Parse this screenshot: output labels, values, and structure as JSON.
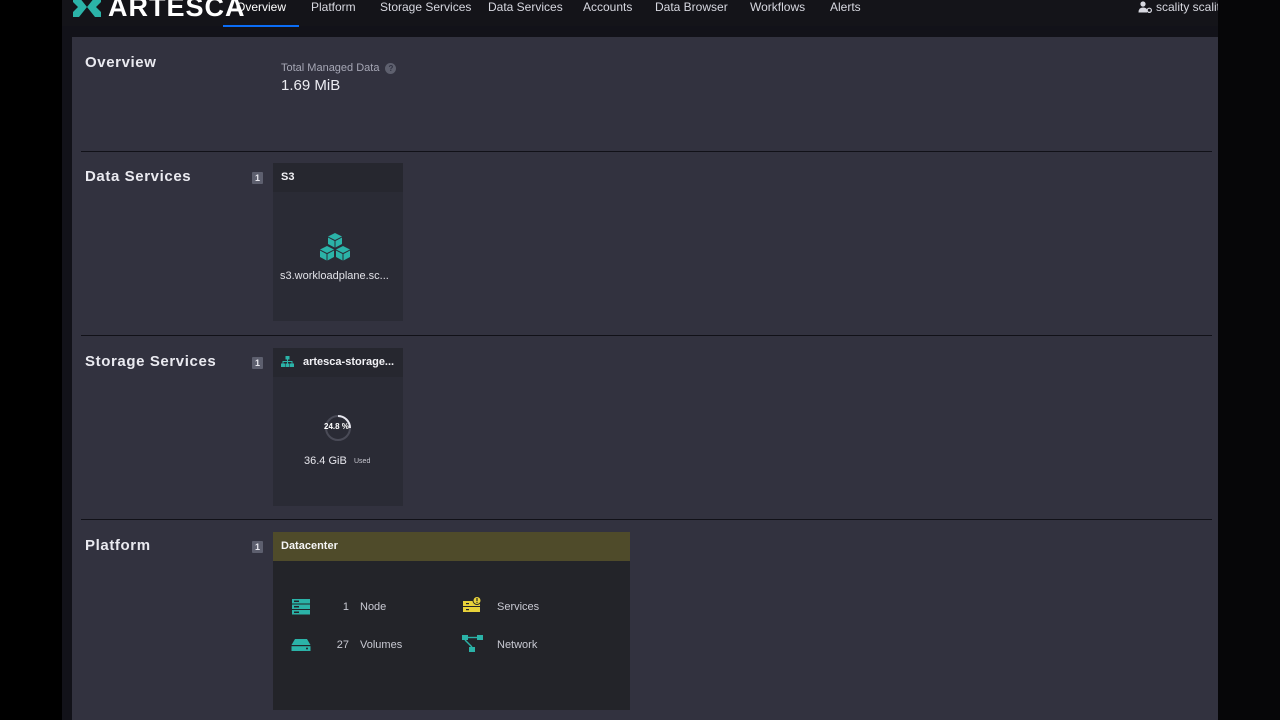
{
  "brand": {
    "name": "ARTESCA"
  },
  "nav": {
    "tabs": [
      {
        "label": "Overview",
        "active": true
      },
      {
        "label": "Platform"
      },
      {
        "label": "Storage Services"
      },
      {
        "label": "Data Services"
      },
      {
        "label": "Accounts"
      },
      {
        "label": "Data Browser"
      },
      {
        "label": "Workflows"
      },
      {
        "label": "Alerts"
      }
    ],
    "user": "scality scalit",
    "user_icon": "user-cog-icon"
  },
  "overview": {
    "title": "Overview",
    "total_managed_label": "Total Managed Data",
    "total_managed_value": "1.69 MiB",
    "help_glyph": "?"
  },
  "data_services": {
    "title": "Data Services",
    "count": "1",
    "card": {
      "title": "S3",
      "endpoint": "s3.workloadplane.sc...",
      "icon": "cubes-icon"
    }
  },
  "storage_services": {
    "title": "Storage Services",
    "count": "1",
    "card": {
      "title": "artesca-storage...",
      "icon": "network-tree-icon",
      "percent_label": "24.8 %",
      "percent_value": 24.8,
      "used_value": "36.4 GiB",
      "used_label": "Used"
    }
  },
  "platform": {
    "title": "Platform",
    "count": "1",
    "card": {
      "title": "Datacenter",
      "stats": [
        {
          "num": "1",
          "label": "Node",
          "icon": "server-icon"
        },
        {
          "num": "27",
          "label": "Volumes",
          "icon": "disk-icon"
        },
        {
          "num": "",
          "label": "Services",
          "icon": "services-warning-icon"
        },
        {
          "num": "",
          "label": "Network",
          "icon": "network-icon"
        }
      ]
    }
  },
  "colors": {
    "accent": "#0b6df6",
    "teal": "#2bb3a8",
    "datacenter_header": "#4f4b2a",
    "warning_yellow": "#e8d23a"
  }
}
